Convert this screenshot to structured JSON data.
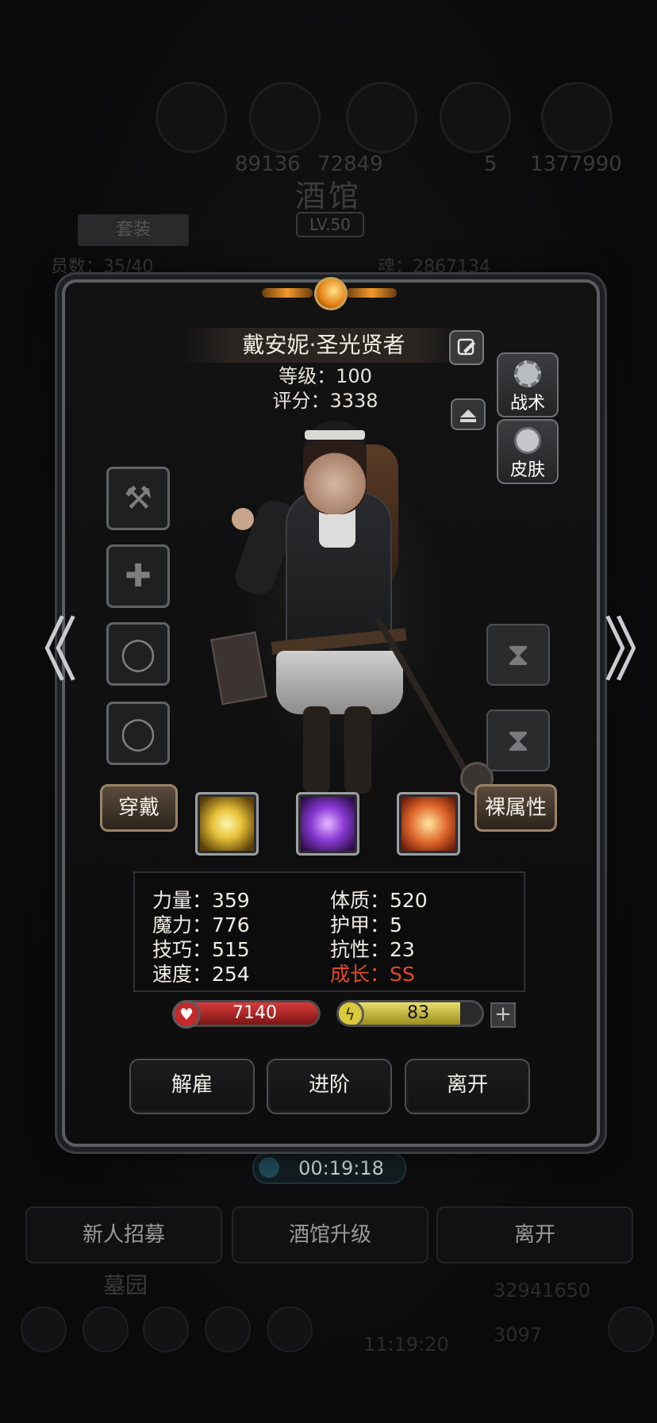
{
  "background": {
    "resource_values": [
      "89136",
      "72849",
      "5",
      "1377990"
    ],
    "title": "酒馆",
    "level_badge": "LV.50",
    "tab_label": "套装",
    "capacity_text": "员数：35/40",
    "soul_text": "魂：2867134",
    "timer": "00:19:18",
    "bottom_buttons": [
      "新人招募",
      "酒馆升级",
      "离开"
    ],
    "section_label": "墓园",
    "gold": "32941650",
    "gems": "3097",
    "clock": "11:19:20"
  },
  "hero": {
    "name": "戴安妮·圣光贤者",
    "level_text": "等级：100",
    "score_text": "评分：3338",
    "side_buttons": [
      {
        "label": "战术",
        "icon": "gear-icon"
      },
      {
        "label": "皮肤",
        "icon": "refresh-icon"
      }
    ],
    "equip_slots": [
      {
        "icon": "hammer-icon",
        "glyph": "⚒"
      },
      {
        "icon": "armor-icon",
        "glyph": "✚"
      },
      {
        "icon": "ring-icon",
        "glyph": "◯"
      },
      {
        "icon": "ring-icon",
        "glyph": "◯"
      }
    ],
    "locked_slots": [
      {
        "icon": "hourglass-icon",
        "glyph": "⧗"
      },
      {
        "icon": "hourglass-icon",
        "glyph": "⧗"
      }
    ],
    "equip_button": "穿戴",
    "bare_attr_button": "裸属性",
    "skills": [
      {
        "icon": "burst-light-icon",
        "color": "#e8c23a"
      },
      {
        "icon": "arcane-rune-icon",
        "color": "#8a3bd6"
      },
      {
        "icon": "holy-shield-icon",
        "color": "#e0682b"
      }
    ],
    "stats_left": [
      "力量：359",
      "魔力：776",
      "技巧：515",
      "速度：254"
    ],
    "stats_right": [
      "体质：520",
      "护甲：5",
      "抗性：23",
      "成长：SS"
    ],
    "growth_color": "#e14a2b",
    "hp": "7140",
    "energy": "83",
    "energy_fraction": 0.85,
    "plus_label": "+",
    "actions": [
      "解雇",
      "进阶",
      "离开"
    ]
  },
  "nav": {
    "prev": "《",
    "next": "》"
  },
  "colors": {
    "hp": "#d83a3a",
    "energy": "#e9de6a",
    "panel_border": "#5b5d62"
  }
}
